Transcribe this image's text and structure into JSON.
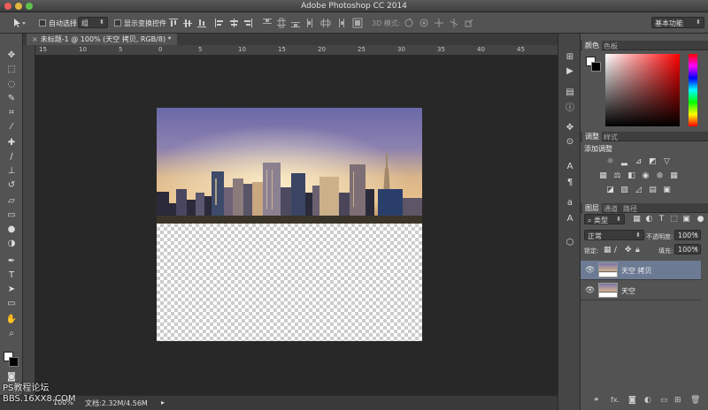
{
  "window": {
    "title": "Adobe Photoshop CC 2014"
  },
  "options_bar": {
    "auto_select_label": "自动选择:",
    "auto_select_value": "组",
    "show_transform_label": "显示变换控件",
    "mode_3d_label": "3D 模式:",
    "workspace": "基本功能"
  },
  "document_tab": {
    "label": "未标题-1 @ 100% (天空 拷贝, RGB/8) *"
  },
  "ruler": {
    "h_ticks": [
      "15",
      "10",
      "5",
      "0",
      "5",
      "10",
      "15",
      "20",
      "25",
      "30",
      "35",
      "40",
      "45"
    ]
  },
  "status": {
    "zoom": "100%",
    "doc_size": "文档:2.32M/4.56M"
  },
  "panels": {
    "color_tabs": [
      "颜色",
      "色板"
    ],
    "adjust_tabs": [
      "调整",
      "样式"
    ],
    "adjust_title": "添加调整",
    "layers_tabs": [
      "图层",
      "通道",
      "路径"
    ],
    "kind_filter": "类型",
    "blend_mode": "正常",
    "opacity_label": "不透明度:",
    "opacity_value": "100%",
    "lock_label": "锁定:",
    "fill_label": "填充:",
    "fill_value": "100%",
    "layers": [
      {
        "name": "天空 拷贝",
        "selected": true
      },
      {
        "name": "天空",
        "selected": false
      }
    ]
  },
  "watermark": {
    "line1": "PS教程论坛",
    "line2": "BBS.16XX8.COM"
  },
  "colors": {
    "accent_selected": "#6c7b93",
    "ui_dark": "#282828"
  }
}
